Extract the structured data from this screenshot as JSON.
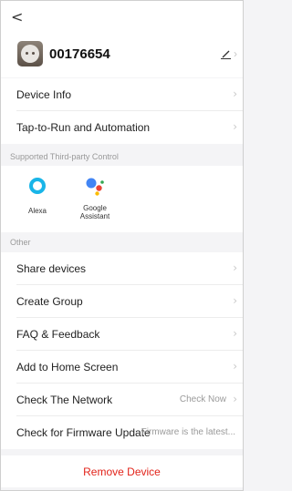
{
  "nav": {
    "back_glyph": "<"
  },
  "device": {
    "name": "00176654",
    "icon": "smart-plug-icon"
  },
  "menu_top": [
    {
      "label": "Device Info"
    },
    {
      "label": "Tap-to-Run and Automation"
    }
  ],
  "third_party": {
    "title": "Supported Third-party Control",
    "items": [
      {
        "label": "Alexa",
        "icon": "alexa-icon"
      },
      {
        "label": "Google Assistant",
        "icon": "google-assistant-icon"
      }
    ]
  },
  "other": {
    "title": "Other",
    "items": [
      {
        "label": "Share devices",
        "value": ""
      },
      {
        "label": "Create Group",
        "value": ""
      },
      {
        "label": "FAQ & Feedback",
        "value": ""
      },
      {
        "label": "Add to Home Screen",
        "value": ""
      },
      {
        "label": "Check The Network",
        "value": "Check Now"
      },
      {
        "label": "Check for Firmware Update",
        "value": "Firmware is the latest..."
      }
    ]
  },
  "remove": {
    "label": "Remove Device"
  },
  "colors": {
    "danger": "#e2231a",
    "alexa": "#19b5e8",
    "google_blue": "#4285f4",
    "google_red": "#ea4335",
    "google_yellow": "#fbbc05",
    "google_green": "#34a853"
  }
}
